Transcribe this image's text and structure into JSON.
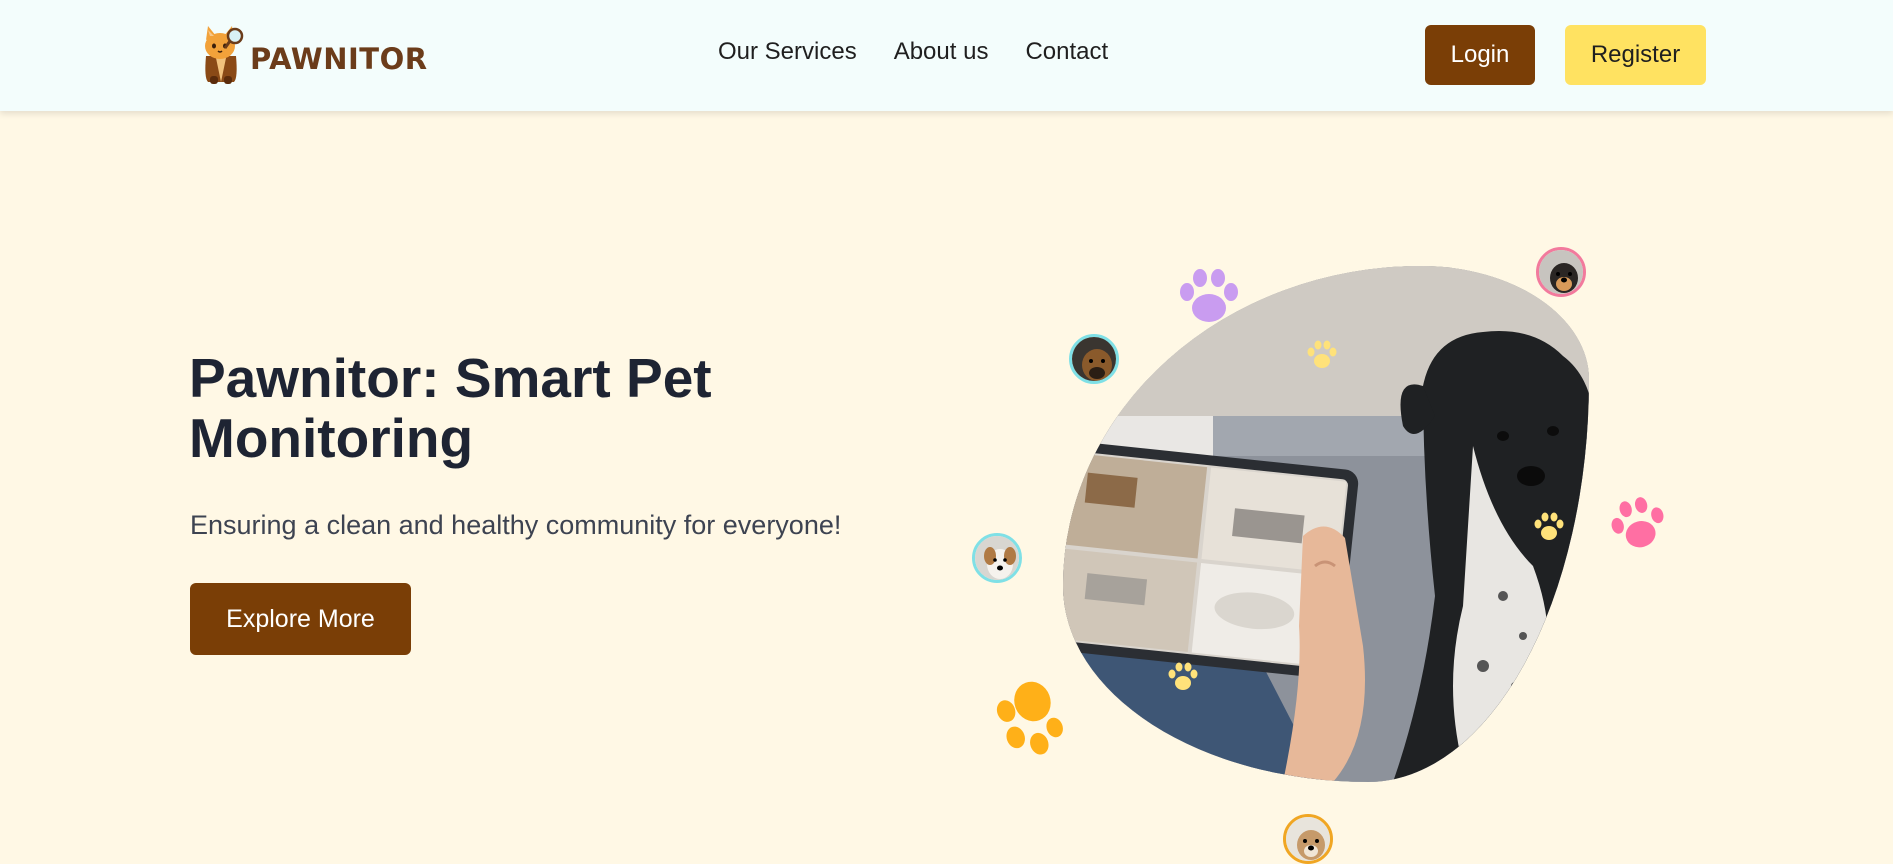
{
  "brand": {
    "name": "PAWNITOR",
    "logo_icon": "cat-mascot-logo"
  },
  "nav": {
    "links": [
      {
        "label": "Our Services"
      },
      {
        "label": "About us"
      },
      {
        "label": "Contact"
      }
    ],
    "login_label": "Login",
    "register_label": "Register"
  },
  "hero": {
    "title": "Pawnitor: Smart Pet Monitoring",
    "subtitle": "Ensuring a clean and healthy community for everyone!",
    "cta_label": "Explore More",
    "image_icon": "tablet-pet-camera-photo"
  },
  "colors": {
    "nav_bg": "#f3fdfc",
    "page_bg": "#fff8e5",
    "primary_brown": "#7a3e06",
    "accent_yellow": "#ffe261",
    "paw_purple": "#c99cf0",
    "paw_pink": "#ff6fa3",
    "paw_orange": "#ffb018",
    "paw_light_yellow": "#ffe27a"
  }
}
